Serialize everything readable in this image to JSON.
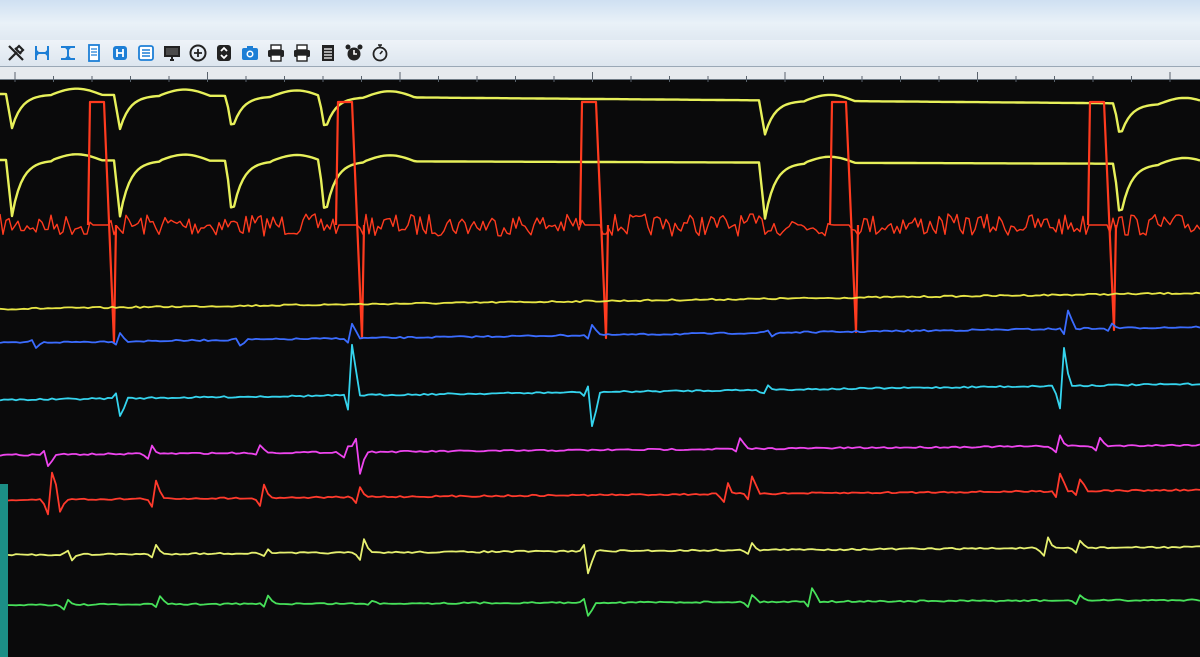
{
  "window": {
    "toolbar": {
      "buttons": [
        {
          "name": "tools",
          "icon": "tools-icon"
        },
        {
          "name": "horizontal-calipers",
          "icon": "horizontal-calipers-icon"
        },
        {
          "name": "vertical-calipers",
          "icon": "vertical-calipers-icon"
        },
        {
          "name": "page",
          "icon": "page-icon"
        },
        {
          "name": "sweep-speed",
          "icon": "sweep-speed-icon"
        },
        {
          "name": "channel-layout",
          "icon": "channel-layout-icon"
        },
        {
          "name": "monitor",
          "icon": "monitor-icon"
        },
        {
          "name": "compass",
          "icon": "compass-icon"
        },
        {
          "name": "scale-adjust",
          "icon": "up-down-arrows-icon"
        },
        {
          "name": "snapshot",
          "icon": "camera-icon"
        },
        {
          "name": "print-screen",
          "icon": "printer-icon"
        },
        {
          "name": "print-page",
          "icon": "printer-icon"
        },
        {
          "name": "review-list",
          "icon": "document-list-icon"
        },
        {
          "name": "alarm",
          "icon": "alarm-clock-icon"
        },
        {
          "name": "timer",
          "icon": "stopwatch-icon"
        }
      ]
    },
    "colors": {
      "background": "#0a0a0b",
      "toolbar": "#e3ebf3",
      "trace_pressure_1": "#e7f05a",
      "trace_pressure_2": "#e7f05a",
      "trace_pacing": "#ff3b1f",
      "trace_baseline": "#e8e645",
      "trace_blue": "#3b6cff",
      "trace_cyan": "#35d4ee",
      "trace_magenta": "#ee45ee",
      "trace_red": "#ff3a2c",
      "trace_yellow": "#e6f070",
      "trace_green": "#47e05a",
      "strip": "#1c8f86"
    }
  }
}
